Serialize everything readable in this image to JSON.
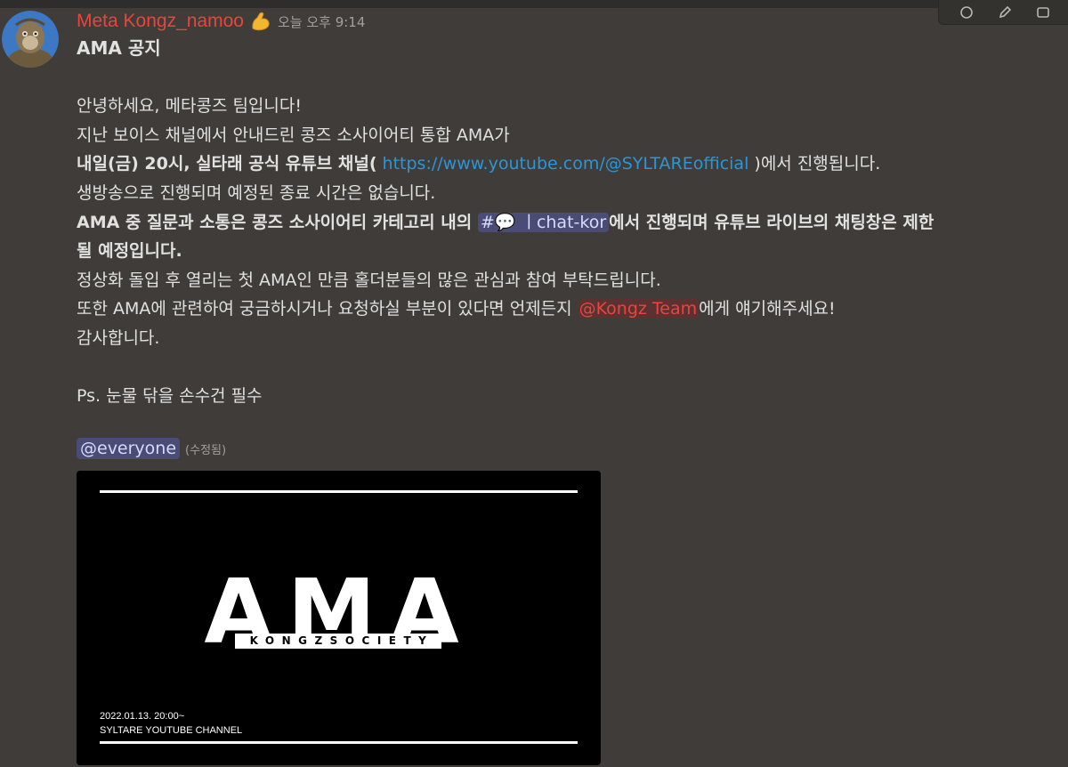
{
  "message": {
    "author": "Meta Kongz_namoo",
    "author_role_icon": "flexed-biceps-icon",
    "timestamp": "오늘 오후 9:14",
    "title": "AMA 공지",
    "greeting": "안녕하세요, 메타콩즈 팀입니다!",
    "line2": "지난 보이스 채널에서 안내드린 콩즈 소사이어티 통합 AMA가",
    "line3_bold": "내일(금) 20시, 실타래 공식 유튜브 채널(",
    "line3_link": " https://www.youtube.com/@SYLTAREofficial ",
    "line3_tail": ")에서 진행됩니다.",
    "line4": "생방송으로 진행되며 예정된 종료 시간은 없습니다.",
    "line5_bold_a": "AMA 중 질문과 소통은 콩즈 소사이어티 카테고리 내의 ",
    "channel_mention": "#💬 ㅣchat-kor",
    "line5_bold_b": "에서 진행되며 유튜브 라이브의 채팅창은 제한",
    "line6_bold": "될 예정입니다.",
    "line7": "정상화 돌입 후 열리는 첫 AMA인 만큼 홀더분들의 많은 관심과 참여 부탁드립니다.",
    "line8_a": "또한 AMA에 관련하여 궁금하시거나 요청하실 부분이 있다면 언제든지 ",
    "role_mention": "@Kongz Team",
    "line8_b": "에게 얘기해주세요!",
    "line9": "감사합니다.",
    "ps": "Ps. 눈물 닦을 손수건 필수",
    "everyone": "@everyone",
    "edited": "(수정됨)"
  },
  "embed": {
    "headline": "AMA",
    "brand": "KONGZSOCIETY",
    "date": "2022.01.13. 20:00~",
    "channel": "SYLTARE YOUTUBE CHANNEL"
  },
  "colors": {
    "background": "#3f3c39",
    "username": "#e8453c",
    "link": "#2e95d6",
    "mention_bg": "#4a4c75"
  }
}
